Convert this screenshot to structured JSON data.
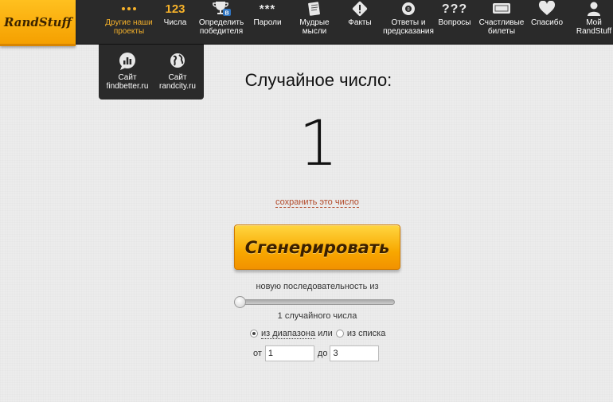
{
  "logo": "RandStuff",
  "nav": [
    {
      "label": "Другие наши проекты",
      "icon": "dots-icon",
      "active": true
    },
    {
      "label": "Числа",
      "icon_text": "123"
    },
    {
      "label": "Определить победителя",
      "icon": "trophy-icon",
      "badge": "B"
    },
    {
      "label": "Пароли",
      "icon_text": "***"
    },
    {
      "label": "Мудрые мысли",
      "icon": "notebook-icon"
    },
    {
      "label": "Факты",
      "icon": "exclamation-icon"
    },
    {
      "label": "Ответы и предсказания",
      "icon": "eight-ball-icon"
    },
    {
      "label": "Вопросы",
      "icon_text": "???"
    },
    {
      "label": "Счастливые билеты",
      "icon": "ticket-icon"
    },
    {
      "label": "Спасибо",
      "icon": "heart-icon"
    },
    {
      "label": "Мой RandStuff",
      "icon": "user-icon"
    }
  ],
  "dropdown": [
    {
      "label": "Сайт findbetter.ru",
      "icon": "chart-bubble-icon"
    },
    {
      "label": "Сайт randcity.ru",
      "icon": "globe-icon"
    }
  ],
  "main": {
    "title": "Случайное число:",
    "result": "1",
    "save_link": "сохранить это число",
    "generate_button": "Сгенерировать",
    "sequence_label": "новую последовательность из",
    "slider_value": 1,
    "count_label": "1 случайного числа",
    "mode": {
      "range_label": "из диапазона",
      "or": "или",
      "list_label": "из списка",
      "selected": "range"
    },
    "range": {
      "from_label": "от",
      "from_value": "1",
      "to_label": "до",
      "to_value": "3"
    }
  },
  "colors": {
    "accent": "#f6b22a",
    "topbar": "#2a2a2a",
    "link": "#b24a2a"
  }
}
